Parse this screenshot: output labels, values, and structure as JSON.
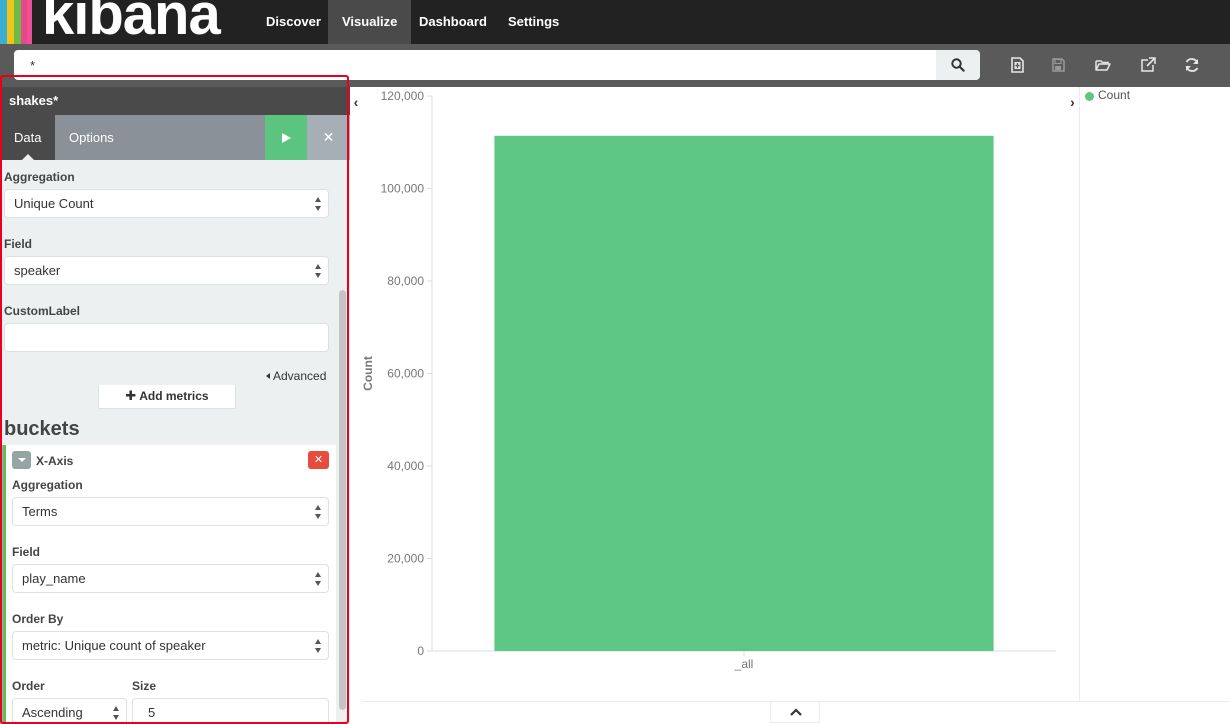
{
  "brand": {
    "name": "kibana",
    "stripe_colors": [
      "#e8478b",
      "#3caed2",
      "#f1c418",
      "#68bc47",
      "#ee5097"
    ]
  },
  "nav": {
    "items": [
      {
        "label": "Discover",
        "active": false
      },
      {
        "label": "Visualize",
        "active": true
      },
      {
        "label": "Dashboard",
        "active": false
      },
      {
        "label": "Settings",
        "active": false
      }
    ]
  },
  "search": {
    "query": "*",
    "icon": "search-icon"
  },
  "toolbar": {
    "icons": [
      "new-visualization-icon",
      "save-icon",
      "open-icon",
      "share-icon",
      "refresh-icon"
    ]
  },
  "vis": {
    "title": "shakes*"
  },
  "tabs": {
    "data_label": "Data",
    "options_label": "Options",
    "discard_glyph": "✕"
  },
  "metrics": {
    "aggregation_label": "Aggregation",
    "aggregation_value": "Unique Count",
    "field_label": "Field",
    "field_value": "speaker",
    "custom_label_label": "CustomLabel",
    "custom_label_value": "",
    "advanced_label": "Advanced",
    "add_metrics_label": "Add metrics"
  },
  "buckets": {
    "heading": "buckets",
    "xaxis_label": "X-Axis",
    "aggregation_label": "Aggregation",
    "aggregation_value": "Terms",
    "field_label": "Field",
    "field_value": "play_name",
    "order_by_label": "Order By",
    "order_by_value": "metric: Unique count of speaker",
    "order_label": "Order",
    "order_value": "Ascending",
    "size_label": "Size",
    "size_value": "5"
  },
  "colors": {
    "bar": "#5ec684",
    "apply": "#5bc57f",
    "remove": "#e74c3c",
    "highlight": "#e8001f"
  },
  "chart_data": {
    "type": "bar",
    "categories": [
      "_all"
    ],
    "series": [
      {
        "name": "Count",
        "values": [
          111396
        ]
      }
    ],
    "ylabel": "Count",
    "xlabel": "",
    "ylim": [
      0,
      120000
    ],
    "yticks": [
      "0",
      "20,000",
      "40,000",
      "60,000",
      "80,000",
      "100,000",
      "120,000"
    ],
    "legend": "right",
    "grid": false
  }
}
